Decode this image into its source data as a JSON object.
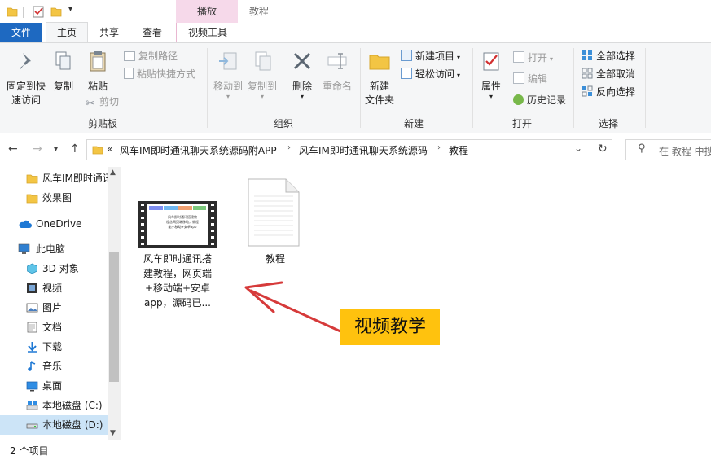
{
  "titlebar": {
    "context_tab": "播放",
    "window_title": "教程"
  },
  "tabs": {
    "file": "文件",
    "home": "主页",
    "share": "共享",
    "view": "查看",
    "video_tools": "视频工具"
  },
  "ribbon": {
    "clipboard": {
      "pin_line1": "固定到快",
      "pin_line2": "速访问",
      "copy": "复制",
      "paste": "粘贴",
      "copy_path": "复制路径",
      "paste_shortcut": "粘贴快捷方式",
      "cut": "剪切",
      "label": "剪贴板"
    },
    "organize": {
      "move_to": "移动到",
      "copy_to": "复制到",
      "delete": "删除",
      "rename": "重命名",
      "label": "组织"
    },
    "new": {
      "new_folder_line1": "新建",
      "new_folder_line2": "文件夹",
      "new_item": "新建项目",
      "easy_access": "轻松访问",
      "label": "新建"
    },
    "open": {
      "properties": "属性",
      "open": "打开",
      "edit": "编辑",
      "history": "历史记录",
      "label": "打开"
    },
    "select": {
      "select_all": "全部选择",
      "select_none": "全部取消",
      "invert": "反向选择",
      "label": "选择"
    }
  },
  "address": {
    "overflow": "«",
    "crumbs": [
      "风车IM即时通讯聊天系统源码附APP",
      "风车IM即时通讯聊天系统源码",
      "教程"
    ],
    "search_placeholder": "在 教程 中搜"
  },
  "sidebar": {
    "items": [
      {
        "label": "风车IM即时通讯",
        "icon": "folder-icon"
      },
      {
        "label": "效果图",
        "icon": "folder-icon"
      },
      {
        "label": "OneDrive",
        "icon": "cloud-icon"
      },
      {
        "label": "此电脑",
        "icon": "computer-icon"
      },
      {
        "label": "3D 对象",
        "icon": "cube-icon"
      },
      {
        "label": "视频",
        "icon": "video-icon"
      },
      {
        "label": "图片",
        "icon": "picture-icon"
      },
      {
        "label": "文档",
        "icon": "document-icon"
      },
      {
        "label": "下载",
        "icon": "download-icon"
      },
      {
        "label": "音乐",
        "icon": "music-icon"
      },
      {
        "label": "桌面",
        "icon": "desktop-icon"
      },
      {
        "label": "本地磁盘 (C:)",
        "icon": "drive-icon"
      },
      {
        "label": "本地磁盘 (D:)",
        "icon": "drive-icon"
      }
    ]
  },
  "files": [
    {
      "name_lines": [
        "风车即时通讯搭",
        "建教程，网页端",
        "+移动端+安卓",
        "app，源码已..."
      ],
      "type": "video",
      "thumb_lines": [
        "风车即时通讯搭建教",
        "程含网页端移动，教程",
        "能小移动+安卓app"
      ]
    },
    {
      "name_lines": [
        "教程"
      ],
      "type": "document"
    }
  ],
  "annotation": {
    "label": "视频教学",
    "color": "#ffc20e",
    "arrow_color": "#d63a3a"
  },
  "status": {
    "item_count": "2 个项目"
  },
  "colors": {
    "file_tab": "#1e69c1",
    "context_tab": "#f6d9ea",
    "ribbon_bg": "#f5f6f7",
    "folder": "#f3c544",
    "selected_row": "#cce4f7"
  }
}
